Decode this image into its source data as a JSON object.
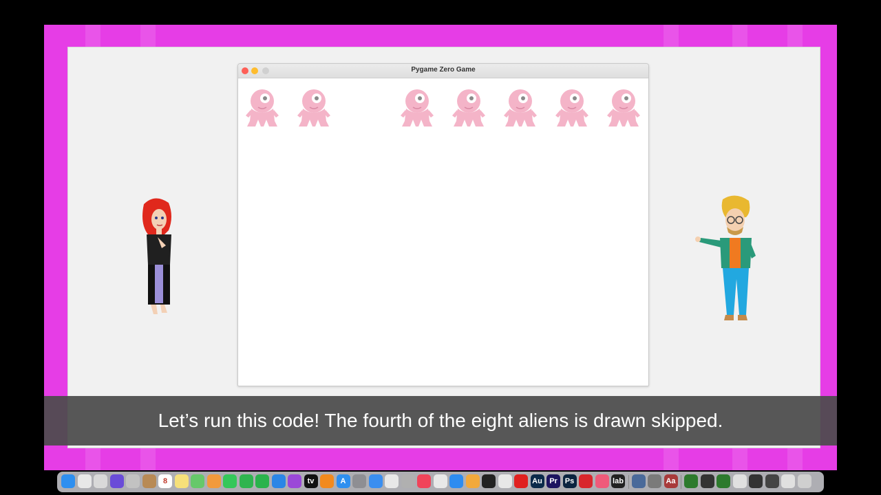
{
  "game_window": {
    "title": "Pygame Zero Game",
    "alien_slots": [
      {
        "drawn": true
      },
      {
        "drawn": true
      },
      {
        "drawn": false
      },
      {
        "drawn": true
      },
      {
        "drawn": true
      },
      {
        "drawn": true
      },
      {
        "drawn": true
      },
      {
        "drawn": true
      }
    ]
  },
  "caption": "Let’s run this code! The fourth of the eight aliens is drawn skipped.",
  "colors": {
    "frame": "#e63de6",
    "alien": "#f4b4c8",
    "caption_band": "#4b4b4b"
  },
  "dock": {
    "apps": [
      {
        "name": "finder-icon",
        "color": "#2e8ff0",
        "glyph": ""
      },
      {
        "name": "launchpad-icon",
        "color": "#e8e8e8",
        "glyph": ""
      },
      {
        "name": "preview-icon",
        "color": "#d9d9d9",
        "glyph": ""
      },
      {
        "name": "siri-icon",
        "color": "#6a4cd8",
        "glyph": ""
      },
      {
        "name": "app-grid-icon",
        "color": "#c2c2c2",
        "glyph": ""
      },
      {
        "name": "folder-icon",
        "color": "#b88a55",
        "glyph": ""
      },
      {
        "name": "calendar-icon",
        "color": "#ffffff",
        "glyph": "8"
      },
      {
        "name": "notes-icon",
        "color": "#f6e07a",
        "glyph": ""
      },
      {
        "name": "maps-icon",
        "color": "#66c86a",
        "glyph": ""
      },
      {
        "name": "photos-icon",
        "color": "#f29a3c",
        "glyph": ""
      },
      {
        "name": "messages-icon",
        "color": "#35c75a",
        "glyph": ""
      },
      {
        "name": "facetime-icon",
        "color": "#2fb44f",
        "glyph": ""
      },
      {
        "name": "numbers-icon",
        "color": "#2ab34c",
        "glyph": ""
      },
      {
        "name": "keynote-icon",
        "color": "#2b86e6",
        "glyph": ""
      },
      {
        "name": "podcasts-icon",
        "color": "#9b48d8",
        "glyph": ""
      },
      {
        "name": "appletv-icon",
        "color": "#111111",
        "glyph": "tv"
      },
      {
        "name": "books-icon",
        "color": "#f28a1e",
        "glyph": ""
      },
      {
        "name": "appstore-icon",
        "color": "#2e8ff0",
        "glyph": "A"
      },
      {
        "name": "settings-icon",
        "color": "#8e8e93",
        "glyph": ""
      },
      {
        "name": "mail-icon",
        "color": "#3a8ef0",
        "glyph": ""
      },
      {
        "name": "slack-icon",
        "color": "#e8e8e8",
        "glyph": ""
      },
      {
        "name": "system-icon",
        "color": "#b0b0b0",
        "glyph": ""
      },
      {
        "name": "music-icon",
        "color": "#f0445a",
        "glyph": ""
      },
      {
        "name": "chrome-icon",
        "color": "#e8e8e8",
        "glyph": ""
      },
      {
        "name": "safari-icon",
        "color": "#2d8cf0",
        "glyph": ""
      },
      {
        "name": "pencil-icon",
        "color": "#f2a93b",
        "glyph": ""
      },
      {
        "name": "terminal-icon",
        "color": "#222222",
        "glyph": ""
      },
      {
        "name": "document-icon",
        "color": "#e8e8e8",
        "glyph": ""
      },
      {
        "name": "acrobat-icon",
        "color": "#e02020",
        "glyph": ""
      },
      {
        "name": "audition-icon",
        "color": "#0a2a4a",
        "glyph": "Au"
      },
      {
        "name": "premiere-icon",
        "color": "#1d1460",
        "glyph": "Pr"
      },
      {
        "name": "photoshop-icon",
        "color": "#0b2440",
        "glyph": "Ps"
      },
      {
        "name": "creative-cloud-icon",
        "color": "#d8262c",
        "glyph": ""
      },
      {
        "name": "app-icon",
        "color": "#ef5a7a",
        "glyph": ""
      },
      {
        "name": "lab-icon",
        "color": "#222222",
        "glyph": "lab"
      },
      {
        "name": "search-icon",
        "color": "#4a6a9a",
        "glyph": ""
      },
      {
        "name": "monitor-icon",
        "color": "#7a7a7a",
        "glyph": ""
      },
      {
        "name": "dictionary-icon",
        "color": "#a83a3a",
        "glyph": "Aa"
      },
      {
        "name": "window-thumb-1-icon",
        "color": "#2d7a2d",
        "glyph": ""
      },
      {
        "name": "window-thumb-2-icon",
        "color": "#333333",
        "glyph": ""
      },
      {
        "name": "window-thumb-3-icon",
        "color": "#2d7a2d",
        "glyph": ""
      },
      {
        "name": "window-thumb-4-icon",
        "color": "#e0e0e0",
        "glyph": ""
      },
      {
        "name": "window-thumb-5-icon",
        "color": "#333333",
        "glyph": ""
      },
      {
        "name": "window-thumb-6-icon",
        "color": "#444444",
        "glyph": ""
      },
      {
        "name": "window-thumb-7-icon",
        "color": "#e0e0e0",
        "glyph": ""
      },
      {
        "name": "trash-icon",
        "color": "#cfcfcf",
        "glyph": ""
      }
    ]
  }
}
